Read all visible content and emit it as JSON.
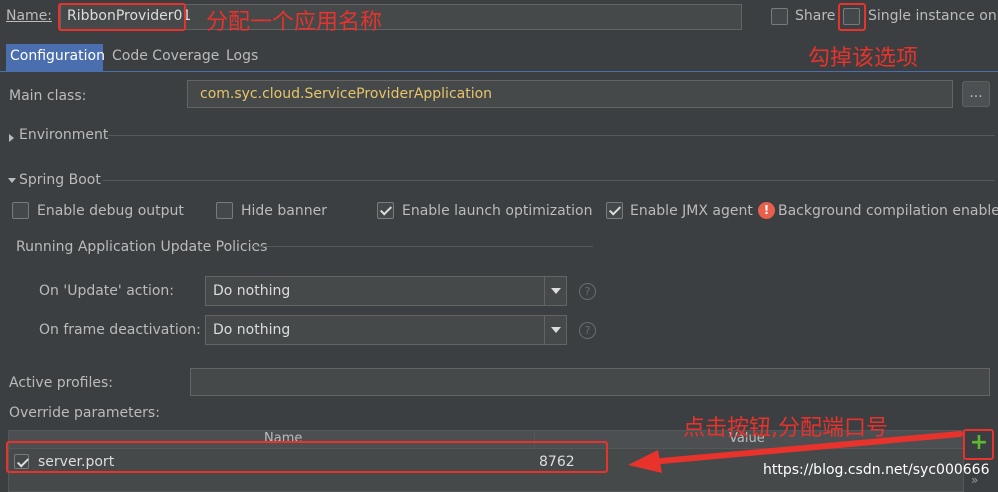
{
  "header": {
    "name_label": "Name:",
    "name_value": "RibbonProvider01",
    "share_label": "Share",
    "single_instance_label": "Single instance only"
  },
  "tabs": [
    {
      "label": "Configuration",
      "active": true
    },
    {
      "label": "Code Coverage",
      "active": false
    },
    {
      "label": "Logs",
      "active": false
    }
  ],
  "main": {
    "main_class_label": "Main class:",
    "main_class_value": "com.syc.cloud.ServiceProviderApplication",
    "browse_label": "...",
    "environment_label": "Environment",
    "spring_boot_label": "Spring Boot"
  },
  "spring": {
    "debug_output": {
      "label": "Enable debug output",
      "checked": false
    },
    "hide_banner": {
      "label": "Hide banner",
      "checked": false
    },
    "launch_optimization": {
      "label": "Enable launch optimization",
      "checked": true
    },
    "jmx_agent": {
      "label": "Enable JMX agent",
      "checked": true
    },
    "warning_text": "Background compilation enabled",
    "policies_label": "Running Application Update Policies",
    "update_action_label": "On 'Update' action:",
    "update_action_value": "Do nothing",
    "frame_deactivation_label": "On frame deactivation:",
    "frame_deactivation_value": "Do nothing",
    "help_glyph": "?"
  },
  "profiles": {
    "active_profiles_label": "Active profiles:",
    "active_profiles_value": "",
    "override_label": "Override parameters:"
  },
  "override_table": {
    "columns": [
      "Name",
      "Value"
    ],
    "rows": [
      {
        "checked": true,
        "name": "server.port",
        "value": "8762"
      }
    ],
    "add_glyph": "+",
    "more_glyph": "»"
  },
  "annotations": {
    "name_note": "分配一个应用名称",
    "uncheck_note": "勾掉该选项",
    "add_note": "点击按钮,分配端口号",
    "watermark": "https://blog.csdn.net/syc000666"
  },
  "colors": {
    "background": "#3c3f41",
    "accent_red": "#e8322c",
    "main_class_text": "#e8c46a",
    "tab_active": "#4b6eaf",
    "add_green": "#5fb832",
    "warning": "#e85f4c"
  }
}
